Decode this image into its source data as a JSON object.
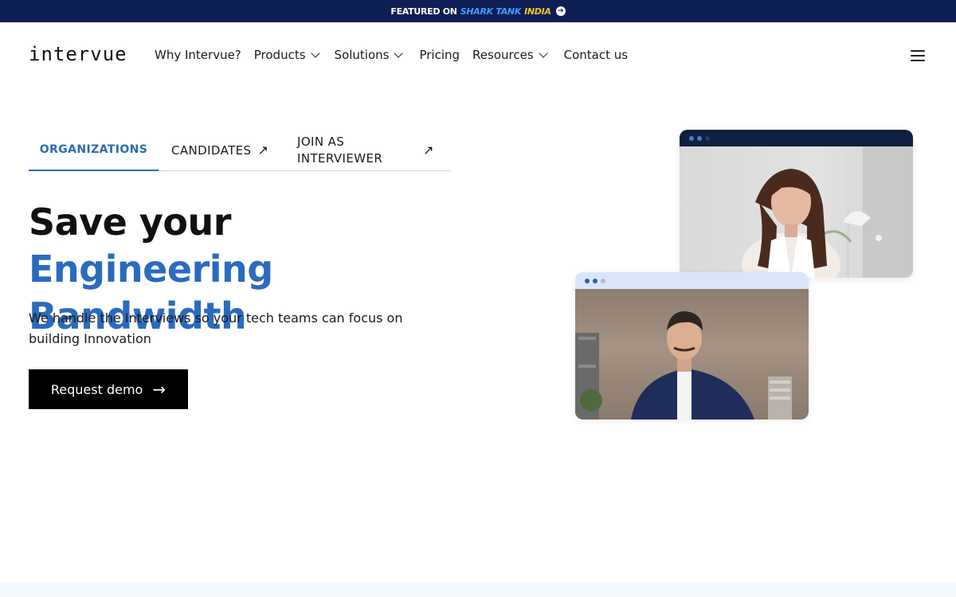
{
  "banner": {
    "featured": "FEATURED ON",
    "shark_tank": "SHARK TANK",
    "india": "INDIA"
  },
  "brand": {
    "logo_text": "intervue"
  },
  "nav": {
    "items": [
      {
        "label": "Why Intervue?",
        "dropdown": false
      },
      {
        "label": "Products",
        "dropdown": true
      },
      {
        "label": "Solutions",
        "dropdown": true
      },
      {
        "label": "Pricing",
        "dropdown": false
      },
      {
        "label": "Resources",
        "dropdown": true
      },
      {
        "label": "Contact us",
        "dropdown": false
      }
    ]
  },
  "tabs": {
    "organizations": "ORGANIZATIONS",
    "candidates": "CANDIDATES",
    "join_interviewer": "JOIN AS INTERVIEWER",
    "active": "organizations"
  },
  "hero": {
    "title_plain": "Save your ",
    "title_highlight": "Engineering Bandwidth",
    "subtitle": "We handle the Interviews so your tech teams can focus on building Innovation",
    "cta_label": "Request demo"
  },
  "colors": {
    "banner_bg": "#0f1d55",
    "accent_blue": "#2a6bbf",
    "cta_bg": "#000000"
  },
  "icons": {
    "tab_external": "arrow-up-right-icon",
    "cta": "arrow-right-icon",
    "menu": "hamburger-menu-icon"
  }
}
